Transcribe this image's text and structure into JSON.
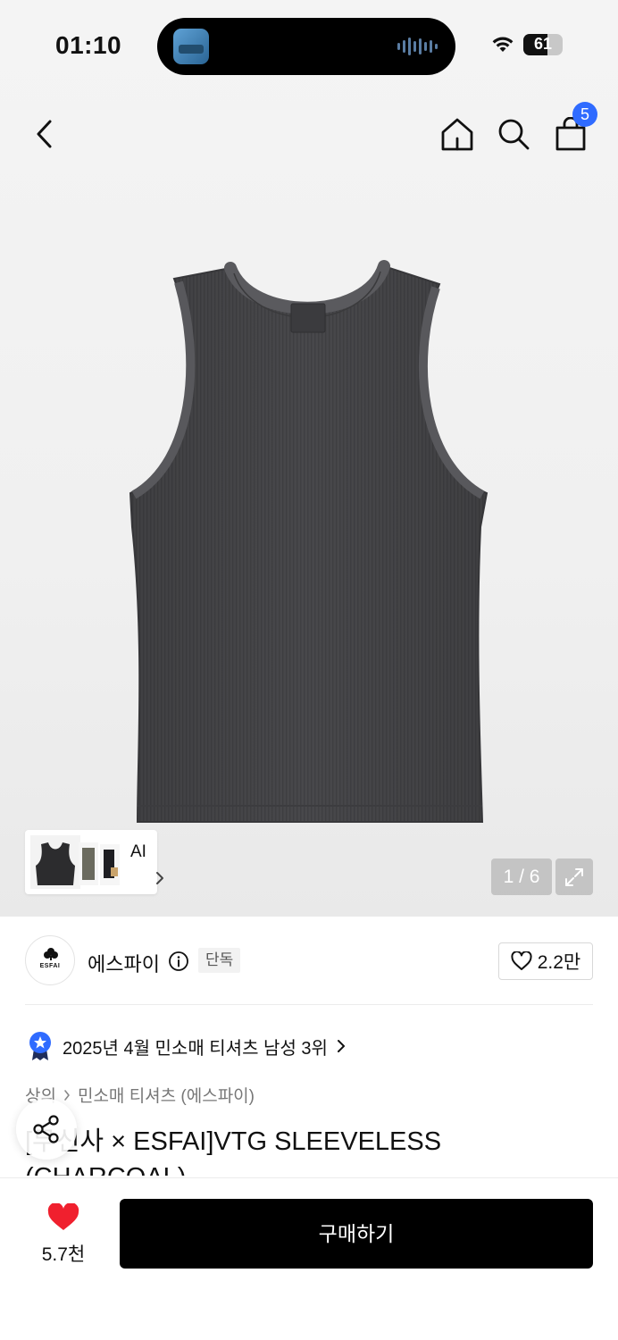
{
  "status_bar": {
    "time": "01:10",
    "battery": "61",
    "battery_level": 0.61
  },
  "nav": {
    "cart_count": "5"
  },
  "gallery": {
    "thumbnail_label": "AI",
    "pager": "1 / 6"
  },
  "brand": {
    "logo_text": "ESFAI",
    "name": "에스파이",
    "badge": "단독",
    "like_count": "2.2만"
  },
  "ranking": {
    "text": "2025년 4월 민소매 티셔츠 남성 3위"
  },
  "breadcrumb": {
    "items": [
      "상의",
      "민소매 티셔츠 (에스파이)"
    ]
  },
  "product": {
    "title": "[무신사 × ESFAI]VTG SLEEVELESS (CHARCOAL)"
  },
  "bottom": {
    "wish_count": "5.7천",
    "buy_label": "구매하기"
  },
  "colors": {
    "accent_blue": "#2f6bff",
    "heart_red": "#f0202e",
    "buy_button": "#000000"
  }
}
